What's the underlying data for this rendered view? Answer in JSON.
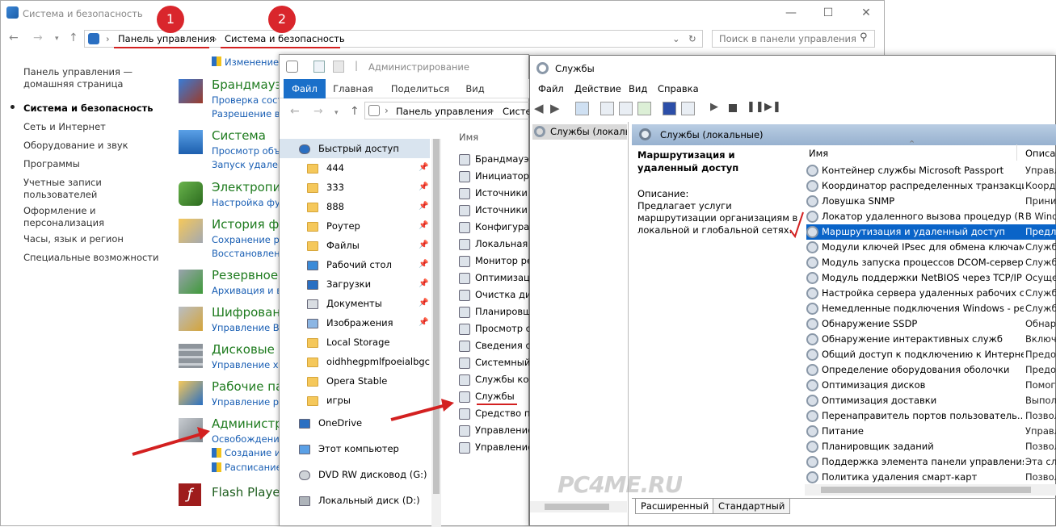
{
  "control_panel": {
    "title": "Система и безопасность",
    "breadcrumb": [
      "Панель управления",
      "Система и безопасность"
    ],
    "search_placeholder": "Поиск в панели управления",
    "badges": [
      "1",
      "2"
    ],
    "sidebar": [
      {
        "label": "Панель управления — домашняя страница",
        "active": false
      },
      {
        "label": "Система и безопасность",
        "active": true
      },
      {
        "label": "Сеть и Интернет",
        "active": false
      },
      {
        "label": "Оборудование и звук",
        "active": false
      },
      {
        "label": "Программы",
        "active": false
      },
      {
        "label": "Учетные записи пользователей",
        "active": false
      },
      {
        "label": "Оформление и персонализация",
        "active": false
      },
      {
        "label": "Часы, язык и регион",
        "active": false
      },
      {
        "label": "Специальные возможности",
        "active": false
      }
    ],
    "top_link": "Изменение",
    "categories": [
      {
        "title": "Брандмауэр",
        "links": [
          "Проверка сост",
          "Разрешение вза"
        ]
      },
      {
        "title": "Система",
        "links": [
          "Просмотр объе",
          "Запуск удален"
        ]
      },
      {
        "title": "Электропит",
        "links": [
          "Настройка фун"
        ]
      },
      {
        "title": "История фа",
        "links": [
          "Сохранение рез",
          "Восстановлен"
        ]
      },
      {
        "title": "Резервное к",
        "links": [
          "Архивация и во"
        ]
      },
      {
        "title": "Шифровани",
        "links": [
          "Управление Bit"
        ]
      },
      {
        "title": "Дисковые п",
        "links": [
          "Управление хра"
        ]
      },
      {
        "title": "Рабочие пап",
        "links": [
          "Управление раб"
        ]
      },
      {
        "title": "Администри",
        "links": [
          "Освобождение",
          "Создание и фо",
          "Расписание"
        ]
      },
      {
        "title": "Flash Player",
        "links": []
      }
    ]
  },
  "explorer": {
    "title": "Администрирование",
    "tabs": [
      "Файл",
      "Главная",
      "Поделиться",
      "Вид"
    ],
    "address": [
      "Панель управления",
      "Систе"
    ],
    "column_header": "Имя",
    "nav": [
      {
        "label": "Быстрый доступ",
        "kind": "star",
        "pinned": false
      },
      {
        "label": "444",
        "kind": "folder",
        "pinned": true
      },
      {
        "label": "333",
        "kind": "folder",
        "pinned": true
      },
      {
        "label": "888",
        "kind": "folder",
        "pinned": true
      },
      {
        "label": "Роутер",
        "kind": "folder",
        "pinned": true
      },
      {
        "label": "Файлы",
        "kind": "folder",
        "pinned": true
      },
      {
        "label": "Рабочий стол",
        "kind": "desktop",
        "pinned": true
      },
      {
        "label": "Загрузки",
        "kind": "download",
        "pinned": true
      },
      {
        "label": "Документы",
        "kind": "doc",
        "pinned": true
      },
      {
        "label": "Изображения",
        "kind": "image",
        "pinned": true
      },
      {
        "label": "Local Storage",
        "kind": "folder",
        "pinned": false
      },
      {
        "label": "oidhhegpmlfpoeialbgcdc",
        "kind": "folder",
        "pinned": false
      },
      {
        "label": "Opera Stable",
        "kind": "folder",
        "pinned": false
      },
      {
        "label": "игры",
        "kind": "folder",
        "pinned": false
      },
      {
        "label": "OneDrive",
        "kind": "cloud",
        "pinned": false
      },
      {
        "label": "Этот компьютер",
        "kind": "pc",
        "pinned": false
      },
      {
        "label": "DVD RW дисковод (G:)",
        "kind": "dvd",
        "pinned": false
      },
      {
        "label": "Локальный диск (D:)",
        "kind": "disk",
        "pinned": false
      }
    ],
    "items": [
      "Брандмауэр",
      "Инициатор",
      "Источники",
      "Источники",
      "Конфигурац",
      "Локальная",
      "Монитор ре",
      "Оптимизаци",
      "Очистка ди",
      "Планировщ",
      "Просмотр с",
      "Сведения о",
      "Системный",
      "Службы ко",
      "Службы",
      "Средство пр",
      "Управление",
      "Управление"
    ]
  },
  "services": {
    "title": "Службы",
    "menu": [
      "Файл",
      "Действие",
      "Вид",
      "Справка"
    ],
    "tree_item": "Службы (локальн",
    "header": "Службы (локальные)",
    "selected_title": "Маршрутизация и удаленный доступ",
    "description_label": "Описание:",
    "description": "Предлагает услуги маршрутизации организациям в локальной и глобальной сетях.",
    "columns": [
      "Имя",
      "Описан"
    ],
    "rows": [
      {
        "name": "Контейнер службы Microsoft Passport",
        "desc": "Управл"
      },
      {
        "name": "Координатор распределенных транзакций",
        "desc": "Коорди"
      },
      {
        "name": "Ловушка SNMP",
        "desc": "Прини"
      },
      {
        "name": "Локатор удаленного вызова процедур (RPC)",
        "desc": "В Wind"
      },
      {
        "name": "Маршрутизация и удаленный доступ",
        "desc": "Предла",
        "selected": true
      },
      {
        "name": "Модули ключей IPsec для обмена ключам...",
        "desc": "Служба"
      },
      {
        "name": "Модуль запуска процессов DCOM-сервера",
        "desc": "Служба"
      },
      {
        "name": "Модуль поддержки NetBIOS через TCP/IP",
        "desc": "Осуще"
      },
      {
        "name": "Настройка сервера удаленных рабочих ст...",
        "desc": "Служба"
      },
      {
        "name": "Немедленные подключения Windows - ре...",
        "desc": "Служба"
      },
      {
        "name": "Обнаружение SSDP",
        "desc": "Обнару"
      },
      {
        "name": "Обнаружение интерактивных служб",
        "desc": "Включ"
      },
      {
        "name": "Общий доступ к подключению к Интерне...",
        "desc": "Предос"
      },
      {
        "name": "Определение оборудования оболочки",
        "desc": "Предос"
      },
      {
        "name": "Оптимизация дисков",
        "desc": "Помога"
      },
      {
        "name": "Оптимизация доставки",
        "desc": "Выпол"
      },
      {
        "name": "Перенаправитель портов пользователь...",
        "desc": "Позвол"
      },
      {
        "name": "Питание",
        "desc": "Управл"
      },
      {
        "name": "Планировщик заданий",
        "desc": "Позвол"
      },
      {
        "name": "Поддержка элемента панели управления ...",
        "desc": "Эта слу"
      },
      {
        "name": "Политика удаления смарт-карт",
        "desc": "Позвол"
      }
    ],
    "bottom_tabs": [
      "Расширенный",
      "Стандартный"
    ]
  },
  "watermark": "PC4ME.RU",
  "colors": {
    "accent": "#0a64c8",
    "badge": "#d9262c",
    "category": "#1e7b1e",
    "link": "#1a5fb4"
  }
}
